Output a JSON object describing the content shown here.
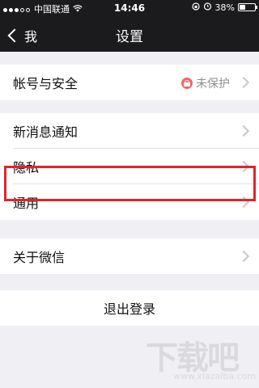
{
  "status_bar": {
    "carrier": "中国联通",
    "time": "14:46",
    "battery": "38%",
    "battery_level": 0.38,
    "signal_dots": [
      true,
      true,
      true,
      false,
      false
    ]
  },
  "nav": {
    "back_label": "我",
    "title": "设置"
  },
  "account": {
    "label": "帐号与安全",
    "badge": "未保护"
  },
  "group2": [
    {
      "label": "新消息通知"
    },
    {
      "label": "隐私"
    },
    {
      "label": "通用"
    }
  ],
  "about": {
    "label": "关于微信"
  },
  "logout": {
    "label": "退出登录"
  },
  "watermark": {
    "text": "下载吧",
    "url": "www.xiazaiba.com"
  },
  "colors": {
    "highlight_border": "#e1242b",
    "badge_lock": "#f36464",
    "nav_bg": "#1b1b1d"
  }
}
